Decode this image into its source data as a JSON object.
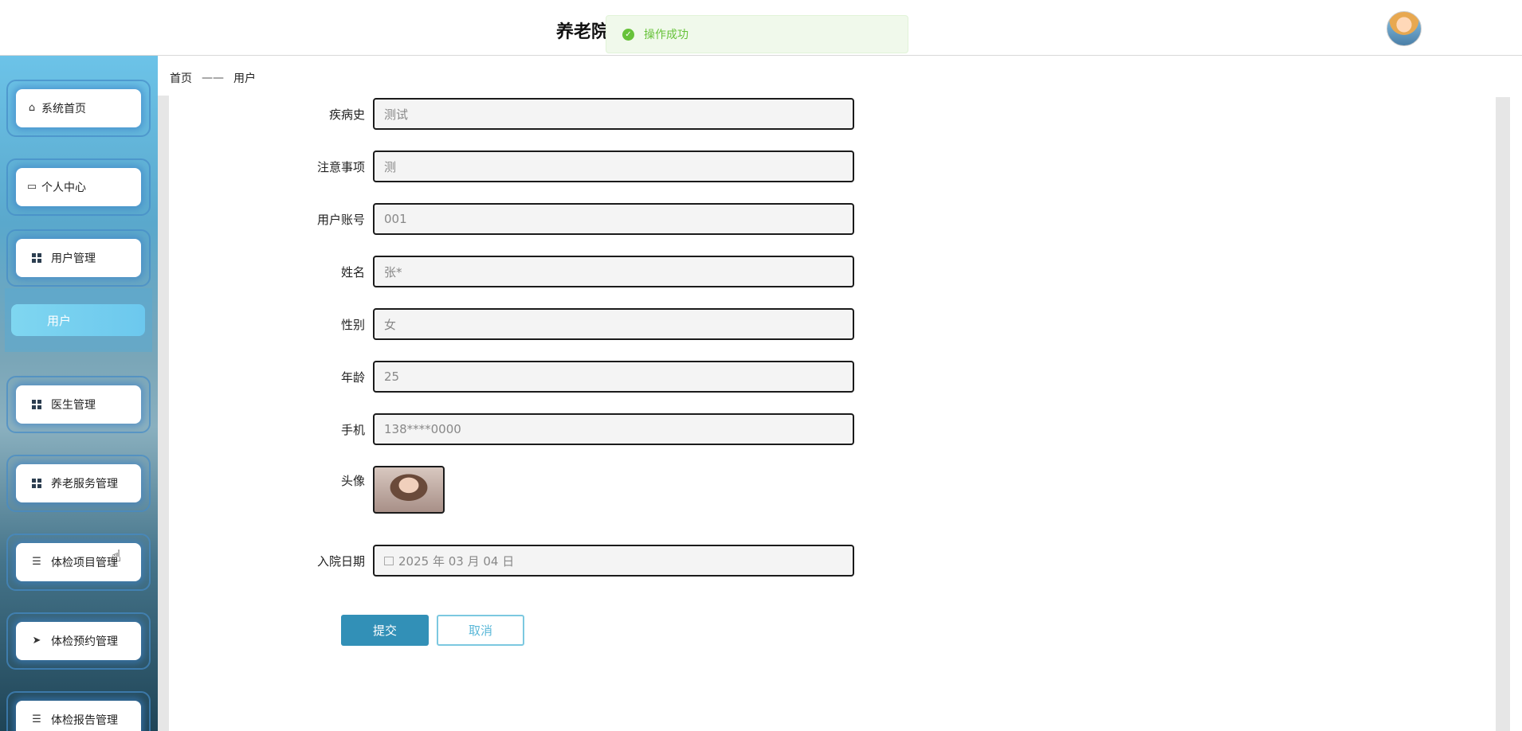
{
  "header": {
    "title": "养老院",
    "toast": "操作成功"
  },
  "sidebar": {
    "items": [
      {
        "label": "系统首页",
        "icon": "home-icon"
      },
      {
        "label": "个人中心",
        "icon": "card-icon"
      },
      {
        "label": "用户管理",
        "icon": "grid-icon"
      },
      {
        "label": "医生管理",
        "icon": "grid-icon"
      },
      {
        "label": "养老服务管理",
        "icon": "grid-icon"
      },
      {
        "label": "体检项目管理",
        "icon": "list-icon"
      },
      {
        "label": "体检预约管理",
        "icon": "send-icon"
      },
      {
        "label": "体检报告管理",
        "icon": "list-icon"
      }
    ],
    "sub_item": "用户"
  },
  "breadcrumb": {
    "home": "首页",
    "separator": "——",
    "current": "用户"
  },
  "form": {
    "medical_history": {
      "label": "疾病史",
      "value": "测试"
    },
    "notes": {
      "label": "注意事项",
      "value": "测"
    },
    "account": {
      "label": "用户账号",
      "value": "001"
    },
    "name": {
      "label": "姓名",
      "value": "张*"
    },
    "gender": {
      "label": "性别",
      "value": "女"
    },
    "age": {
      "label": "年龄",
      "value": "25"
    },
    "phone": {
      "label": "手机",
      "value": "138****0000"
    },
    "avatar": {
      "label": "头像"
    },
    "admission_date": {
      "label": "入院日期",
      "value": "2025 年 03 月 04 日"
    }
  },
  "buttons": {
    "submit": "提交",
    "cancel": "取消"
  },
  "colors": {
    "primary": "#3290b7",
    "success": "#67c23a"
  }
}
